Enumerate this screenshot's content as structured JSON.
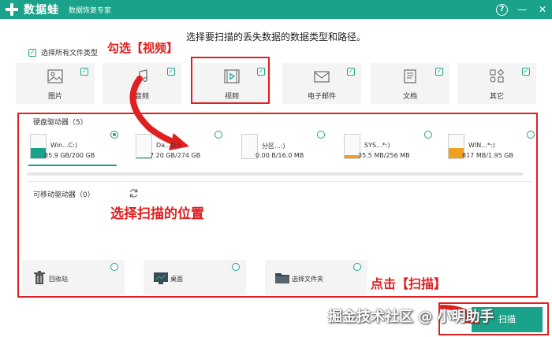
{
  "app": {
    "name": "数据蛙",
    "subtitle": "数据恢复专家",
    "help": "?",
    "minimize": "—",
    "close": "✕"
  },
  "subtitle": "选择要扫描的丢失数据的数据类型和路径。",
  "select_all": {
    "label": "选择所有文件类型",
    "checked": true
  },
  "file_types": [
    {
      "label": "图片",
      "icon": "image-icon",
      "checked": true
    },
    {
      "label": "音频",
      "icon": "music-icon",
      "checked": true
    },
    {
      "label": "视频",
      "icon": "video-icon",
      "checked": true
    },
    {
      "label": "电子邮件",
      "icon": "mail-icon",
      "checked": true
    },
    {
      "label": "文档",
      "icon": "document-icon",
      "checked": true
    },
    {
      "label": "其它",
      "icon": "other-icon",
      "checked": true
    }
  ],
  "annotations": {
    "check_video": "勾选【视频】",
    "choose_location": "选择扫描的位置",
    "click_scan": "点击【扫描】",
    "watermark": "掘金技术社区 @ 小明助手"
  },
  "hard_drives": {
    "title": "硬盘驱动器（5）",
    "items": [
      {
        "name": "Win...C:)",
        "size": "85.9 GB/200 GB",
        "selected": true,
        "fill_color": "#1aa38a",
        "fill_fraction": 0.43
      },
      {
        "name": "Da...D:)",
        "size": "7.20 GB/274 GB",
        "selected": false,
        "fill_color": "#1aa38a",
        "fill_fraction": 0.03
      },
      {
        "name": "分区...:)",
        "size": "0.00  B/16.0 MB",
        "selected": false,
        "fill_color": "#1aa38a",
        "fill_fraction": 0.0
      },
      {
        "name": "SYS...*:)",
        "size": "35.5 MB/256 MB",
        "selected": false,
        "fill_color": "#f0a020",
        "fill_fraction": 0.14
      },
      {
        "name": "WIN...*:)",
        "size": "817 MB/1.95 GB",
        "selected": false,
        "fill_color": "#f0a020",
        "fill_fraction": 0.42
      }
    ]
  },
  "removable": {
    "title": "可移动驱动器（0）",
    "refresh_icon": "refresh-icon"
  },
  "locations": [
    {
      "label": "回收站",
      "icon": "recycle-bin-icon"
    },
    {
      "label": "桌面",
      "icon": "desktop-icon"
    },
    {
      "label": "选择文件夹",
      "icon": "folder-icon"
    }
  ],
  "scan_button": {
    "label": "扫描"
  },
  "colors": {
    "accent": "#1aa38a",
    "annotation": "#e02020",
    "warning": "#f0a020"
  }
}
